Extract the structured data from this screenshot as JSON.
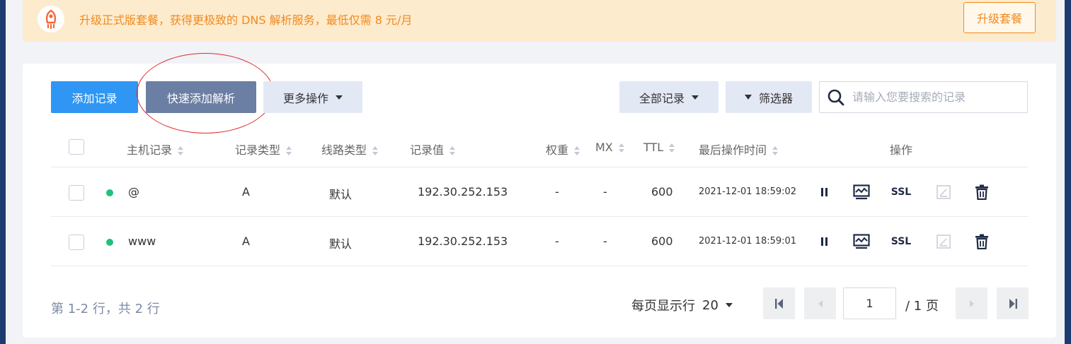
{
  "banner": {
    "text": "升级正式版套餐，获得更极致的 DNS 解析服务，最低仅需 8 元/月",
    "button": "升级套餐",
    "icon": "rocket-icon",
    "accent": "#f08a1e"
  },
  "toolbar": {
    "add_record": "添加记录",
    "quick_add": "快速添加解析",
    "more_ops": "更多操作",
    "all_records": "全部记录",
    "filter": "筛选器",
    "search_placeholder": "请输入您要搜索的记录"
  },
  "table": {
    "columns": [
      "主机记录",
      "记录类型",
      "线路类型",
      "记录值",
      "权重",
      "MX",
      "TTL",
      "最后操作时间",
      "操作"
    ],
    "rows": [
      {
        "host": "@",
        "type": "A",
        "line": "默认",
        "value": "192.30.252.153",
        "weight": "-",
        "mx": "-",
        "ttl": "600",
        "time": "2021-12-01 18:59:02",
        "status": "enabled"
      },
      {
        "host": "www",
        "type": "A",
        "line": "默认",
        "value": "192.30.252.153",
        "weight": "-",
        "mx": "-",
        "ttl": "600",
        "time": "2021-12-01 18:59:01",
        "status": "enabled"
      }
    ],
    "ssl_label": "SSL"
  },
  "footer": {
    "summary": "第 1-2 行，共 2 行",
    "per_page_label": "每页显示行",
    "per_page_value": "20",
    "current_page": "1",
    "total_pages": "/ 1 页"
  },
  "colors": {
    "primary": "#2f96f3",
    "secondary": "#6b7ea3",
    "status_ok": "#1fc17c",
    "annotation": "#e02a2a"
  }
}
